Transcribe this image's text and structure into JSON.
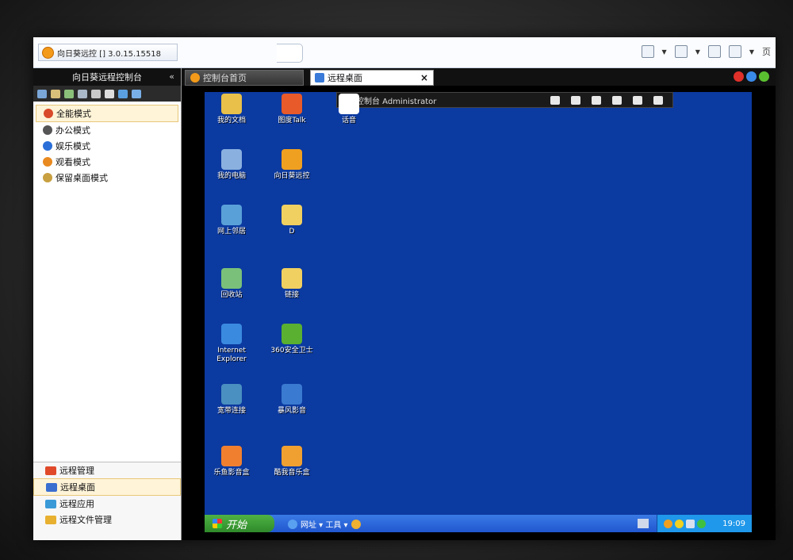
{
  "browser": {
    "tab_title": "向日葵远控 [] 3.0.15.15518",
    "toolbar_page_label": "页"
  },
  "sidebar": {
    "header": "向日葵远程控制台",
    "collapse": "«",
    "modes": [
      {
        "label": "全能模式",
        "selected": true,
        "color": "#d84a2a"
      },
      {
        "label": "办公模式",
        "selected": false,
        "color": "#555555"
      },
      {
        "label": "娱乐模式",
        "selected": false,
        "color": "#2a6fd8"
      },
      {
        "label": "观看模式",
        "selected": false,
        "color": "#e88a20"
      },
      {
        "label": "保留桌面模式",
        "selected": false,
        "color": "#c8a040"
      }
    ],
    "bottom_nav": [
      {
        "label": "远程管理",
        "selected": false,
        "color": "#e04a2a"
      },
      {
        "label": "远程桌面",
        "selected": true,
        "color": "#3a6fd0"
      },
      {
        "label": "远程应用",
        "selected": false,
        "color": "#3a9ad8"
      },
      {
        "label": "远程文件管理",
        "selected": false,
        "color": "#e8b030"
      }
    ]
  },
  "tabs": {
    "home": "控制台首页",
    "active": "远程桌面",
    "close": "×"
  },
  "remote": {
    "bar_title": "控制台 Administrator",
    "desktop_icons": [
      {
        "label": "我的文档",
        "color": "#e8c04a"
      },
      {
        "label": "图度Talk",
        "color": "#e85a2a"
      },
      {
        "label": "话音",
        "color": "#ffffff"
      },
      {
        "label": "我的电脑",
        "color": "#8ab0e0"
      },
      {
        "label": "向日葵远控",
        "color": "#f0a020"
      },
      {
        "label": "网上邻居",
        "color": "#5aa0d8"
      },
      {
        "label": "D",
        "color": "#f0d060"
      },
      {
        "label": "回收站",
        "color": "#7ac07a"
      },
      {
        "label": "链接",
        "color": "#f0d060"
      },
      {
        "label": "Internet Explorer",
        "color": "#3a8ae0"
      },
      {
        "label": "360安全卫士",
        "color": "#5ab030"
      },
      {
        "label": "宽带连接",
        "color": "#4a90c0"
      },
      {
        "label": "暴风影音",
        "color": "#3a7ad0"
      },
      {
        "label": "乐鱼影音盒",
        "color": "#f08030"
      },
      {
        "label": "酷我音乐盒",
        "color": "#f0a030"
      }
    ],
    "taskbar": {
      "start": "开始",
      "quicklaunch": "网址 ▾ 工具 ▾",
      "clock": "19:09"
    }
  }
}
